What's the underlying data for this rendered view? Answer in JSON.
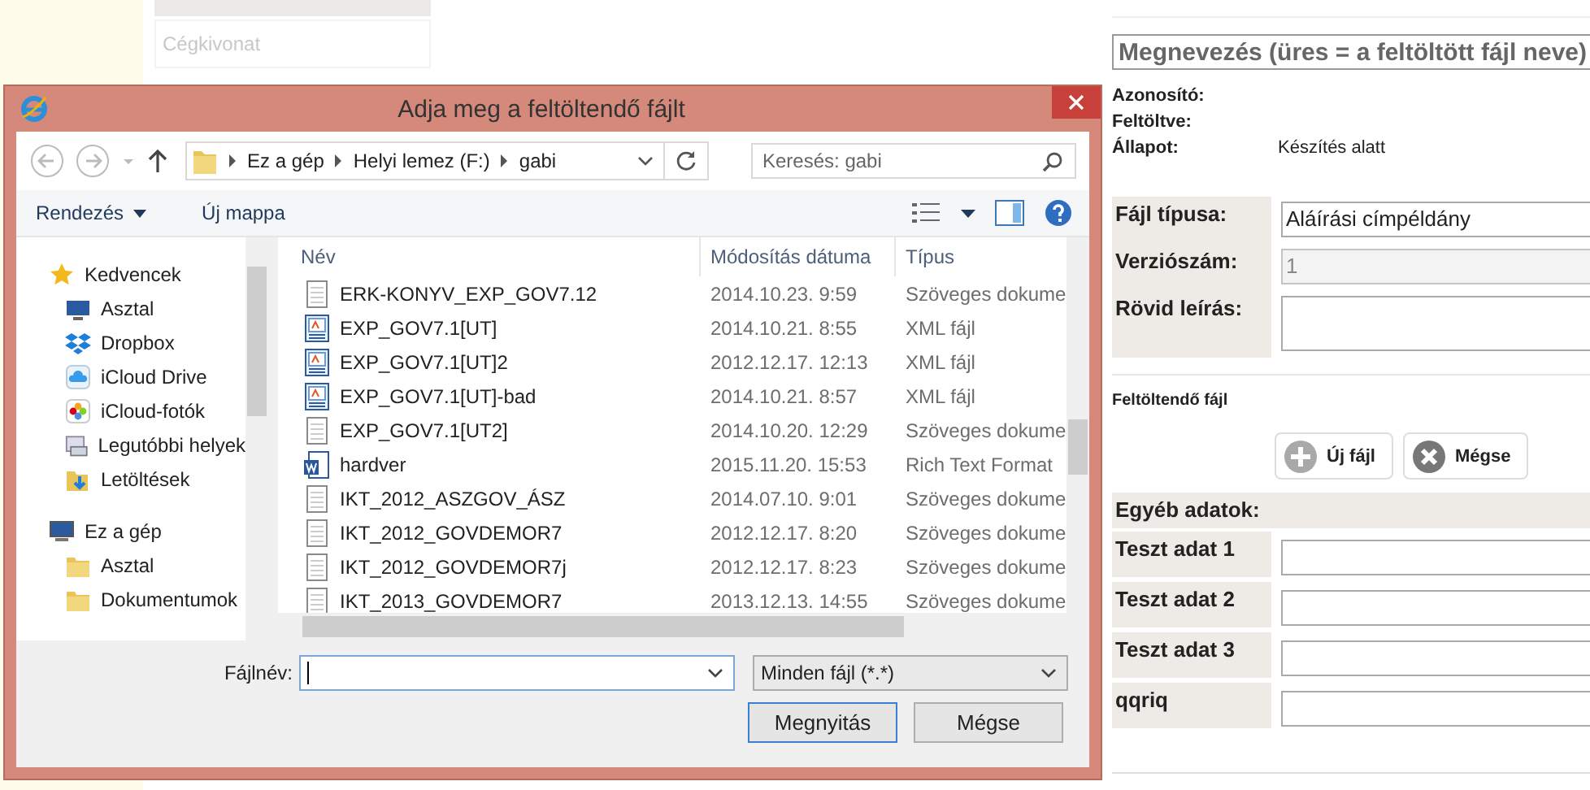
{
  "background": {
    "doc_types": [
      {
        "label": "Cégkivonat",
        "selected": false
      }
    ],
    "form": {
      "name_placeholder": "Megnevezés (üres = a feltöltött fájl neve)",
      "info": [
        {
          "label": "Azonosító:"
        },
        {
          "label": "Feltöltve:"
        },
        {
          "label": "Állapot:",
          "value": "Készítés alatt"
        }
      ],
      "fields": [
        {
          "label": "Fájl típusa:",
          "value": "Aláírási címpéldány",
          "disabled": false,
          "kind": "line"
        },
        {
          "label": "Verziószám:",
          "value": "1",
          "disabled": true,
          "kind": "line"
        },
        {
          "label": "Rövid leírás:",
          "disabled": false,
          "kind": "area"
        }
      ],
      "upload_label": "Feltöltendő fájl",
      "upload_buttons": [
        {
          "label": "Új fájl",
          "kind": "add"
        },
        {
          "label": "Mégse",
          "kind": "cancel"
        }
      ],
      "other_heading": "Egyéb adatok:",
      "other_fields": [
        {
          "label": "Teszt adat 1"
        },
        {
          "label": "Teszt adat 2"
        },
        {
          "label": "Teszt adat 3"
        },
        {
          "label": "qqriq"
        }
      ]
    }
  },
  "dialog": {
    "title": "Adja meg a feltöltendő fájlt",
    "breadcrumb": [
      "Ez a gép",
      "Helyi lemez (F:)",
      "gabi"
    ],
    "search": {
      "placeholder": "Keresés: gabi"
    },
    "toolbar": {
      "organize": "Rendezés",
      "new_folder": "Új mappa"
    },
    "sidebar": [
      {
        "label": "Kedvencek",
        "kind": "star",
        "group": true
      },
      {
        "label": "Asztal",
        "kind": "desktop",
        "group": false
      },
      {
        "label": "Dropbox",
        "kind": "dropbox",
        "group": false
      },
      {
        "label": "iCloud Drive",
        "kind": "cloud",
        "group": false
      },
      {
        "label": "iCloud-fotók",
        "kind": "photos",
        "group": false
      },
      {
        "label": "Legutóbbi helyek",
        "kind": "recent",
        "group": false
      },
      {
        "label": "Letöltések",
        "kind": "downloads",
        "group": false
      },
      {
        "label": "Ez a gép",
        "kind": "computer",
        "group": true
      },
      {
        "label": "Asztal",
        "kind": "folder",
        "group": false
      },
      {
        "label": "Dokumentumok",
        "kind": "folder",
        "group": false
      }
    ],
    "columns": [
      "Név",
      "Módosítás dátuma",
      "Típus"
    ],
    "files": [
      {
        "name": "ERK-KONYV_EXP_GOV7.12",
        "date": "2014.10.23. 9:59",
        "type": "Szöveges dokume",
        "kind": "text"
      },
      {
        "name": "EXP_GOV7.1[UT]",
        "date": "2014.10.21. 8:55",
        "type": "XML fájl",
        "kind": "xml"
      },
      {
        "name": "EXP_GOV7.1[UT]2",
        "date": "2012.12.17. 12:13",
        "type": "XML fájl",
        "kind": "xml"
      },
      {
        "name": "EXP_GOV7.1[UT]-bad",
        "date": "2014.10.21. 8:57",
        "type": "XML fájl",
        "kind": "xml"
      },
      {
        "name": "EXP_GOV7.1[UT2]",
        "date": "2014.10.20. 12:29",
        "type": "Szöveges dokume",
        "kind": "text"
      },
      {
        "name": "hardver",
        "date": "2015.11.20. 15:53",
        "type": "Rich Text Format",
        "kind": "word"
      },
      {
        "name": "IKT_2012_ASZGOV_ÁSZ",
        "date": "2014.07.10. 9:01",
        "type": "Szöveges dokume",
        "kind": "text"
      },
      {
        "name": "IKT_2012_GOVDEMOR7",
        "date": "2012.12.17. 8:20",
        "type": "Szöveges dokume",
        "kind": "text"
      },
      {
        "name": "IKT_2012_GOVDEMOR7j",
        "date": "2012.12.17. 8:23",
        "type": "Szöveges dokume",
        "kind": "text"
      },
      {
        "name": "IKT_2013_GOVDEMOR7",
        "date": "2013.12.13. 14:55",
        "type": "Szöveges dokume",
        "kind": "text"
      }
    ],
    "filename_label": "Fájlnév:",
    "filter": "Minden fájl (*.*)",
    "buttons": [
      {
        "label": "Megnyitás",
        "default": true
      },
      {
        "label": "Mégse",
        "default": false
      }
    ]
  }
}
